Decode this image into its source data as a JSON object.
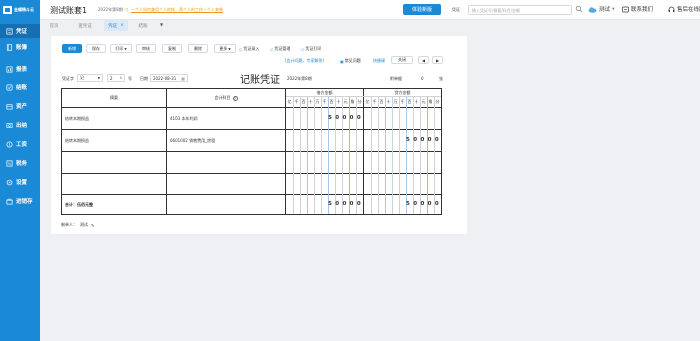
{
  "sidebar": {
    "logo_text": "金蝶精斗云",
    "items": [
      {
        "label": "凭证",
        "icon": "voucher-icon",
        "active": true
      },
      {
        "label": "账簿",
        "icon": "ledger-icon",
        "active": false
      },
      {
        "label": "报表",
        "icon": "report-icon",
        "active": false
      },
      {
        "label": "结账",
        "icon": "closing-icon",
        "active": false
      },
      {
        "label": "资产",
        "icon": "asset-icon",
        "active": false
      },
      {
        "label": "出纳",
        "icon": "cashier-icon",
        "active": false
      },
      {
        "label": "工资",
        "icon": "payroll-icon",
        "active": false
      },
      {
        "label": "税务",
        "icon": "tax-icon",
        "active": false
      },
      {
        "label": "设置",
        "icon": "settings-icon",
        "active": false
      },
      {
        "label": "进销存",
        "icon": "inventory-icon",
        "active": false
      }
    ]
  },
  "topbar": {
    "title": "测试账套1",
    "period": "2022年第8期",
    "notice": "一个人如何兼用个人的帐，两个人的工作一个人来做",
    "trial_button": "体验新版",
    "search_type": "凭证",
    "search_placeholder": "输入凭证号/摘要/科目/金额",
    "user": "测试",
    "contact": "联系我们",
    "service": "售后在线服务"
  },
  "tabs": [
    {
      "label": "首页"
    },
    {
      "label": "查凭证"
    },
    {
      "label": "凭证",
      "active": true
    },
    {
      "label": "结账"
    }
  ],
  "toolbar": {
    "new": "新增",
    "save": "保存",
    "print": "打印",
    "audit": "审核",
    "copy": "复制",
    "delete": "删除",
    "more": "更多",
    "import": "凭证录入",
    "manage": "凭证管理",
    "print_voucher": "凭证打印",
    "faq_link": "[会计问题，专家解答]",
    "common_issue": "常见问题",
    "shortcut": "快捷键",
    "close": "关闭",
    "prev": "◀",
    "next": "▶"
  },
  "voucher": {
    "word_label": "凭证字",
    "word": "记",
    "number": "2",
    "number_suffix": "号",
    "date_label": "日期",
    "date": "2022-08-31",
    "title": "记账凭证",
    "period_text": "2022年第8期",
    "attachments_label": "附单据",
    "attachments": "0",
    "attachments_unit": "张",
    "headers": {
      "summary": "摘要",
      "account": "会计科目",
      "debit": "借方金额",
      "credit": "贷方金额"
    },
    "digit_labels": [
      "亿",
      "千",
      "百",
      "十",
      "万",
      "千",
      "百",
      "十",
      "元",
      "角",
      "分"
    ],
    "rows": [
      {
        "summary": "结转本期损益",
        "account": "4103 本年利润",
        "debit": "50000",
        "credit": ""
      },
      {
        "summary": "结转本期损益",
        "account": "6601002 销售费用_房租",
        "debit": "",
        "credit": "50000"
      },
      {
        "summary": "",
        "account": "",
        "debit": "",
        "credit": ""
      },
      {
        "summary": "",
        "account": "",
        "debit": "",
        "credit": ""
      }
    ],
    "total_label": "合计：伍佰元整",
    "total_debit": "50000",
    "total_credit": "50000",
    "maker_label": "制单人：",
    "maker": "测试"
  }
}
